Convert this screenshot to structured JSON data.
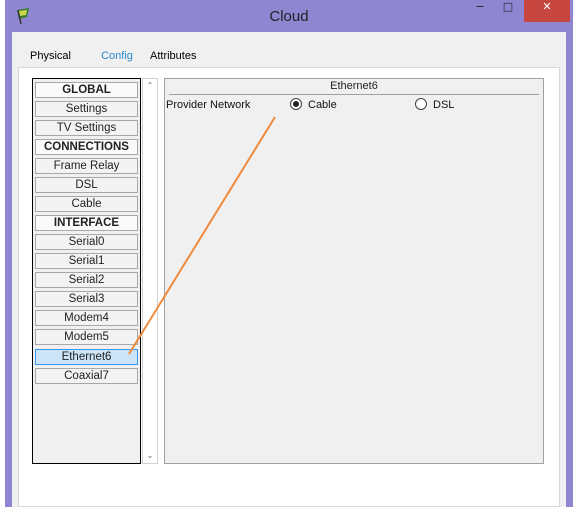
{
  "window": {
    "title": "Cloud",
    "controls": {
      "minimize": "−",
      "maximize": "□",
      "close": "✕"
    }
  },
  "tabs": [
    "Physical",
    "Config",
    "Attributes"
  ],
  "sidebar": {
    "items": [
      {
        "label": "GLOBAL",
        "header": true
      },
      {
        "label": "Settings"
      },
      {
        "label": "TV Settings"
      },
      {
        "label": "CONNECTIONS",
        "header": true
      },
      {
        "label": "Frame Relay"
      },
      {
        "label": "DSL"
      },
      {
        "label": "Cable"
      },
      {
        "label": "INTERFACE",
        "header": true
      },
      {
        "label": "Serial0"
      },
      {
        "label": "Serial1"
      },
      {
        "label": "Serial2"
      },
      {
        "label": "Serial3"
      },
      {
        "label": "Modem4"
      },
      {
        "label": "Modem5"
      },
      {
        "label": "Ethernet6",
        "selected": true
      },
      {
        "label": "Coaxial7"
      }
    ]
  },
  "scrollbar": {
    "up": "⌃",
    "down": "⌄"
  },
  "detail": {
    "title": "Ethernet6",
    "provider_label": "Provider Network",
    "options": [
      {
        "label": "Cable",
        "checked": true
      },
      {
        "label": "DSL",
        "checked": false
      }
    ]
  },
  "colors": {
    "window_frame": "#8f86d2",
    "close_button": "#c7463f",
    "accent": "#2a8ac8",
    "annotation": "#f08a3c"
  }
}
